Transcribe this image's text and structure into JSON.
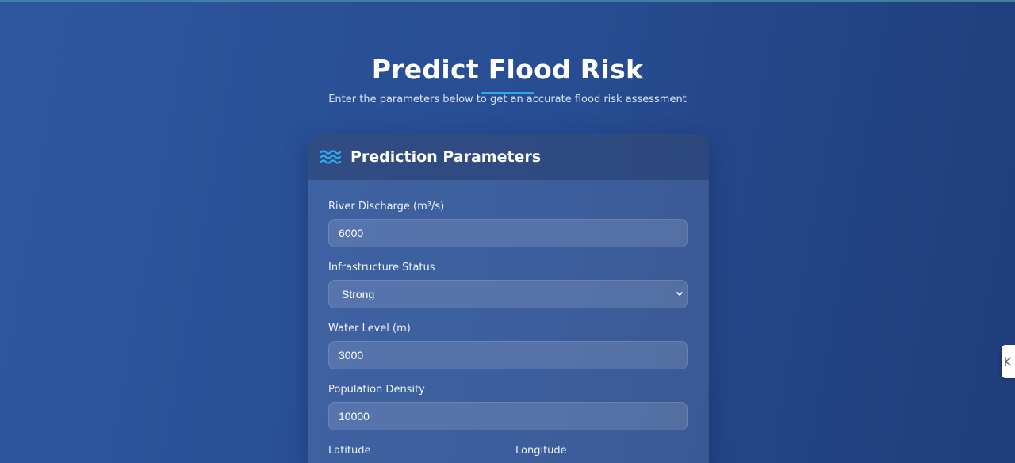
{
  "page": {
    "title": "Predict Flood Risk",
    "subtitle": "Enter the parameters below to get an accurate flood risk assessment"
  },
  "card": {
    "icon": "water-waves-icon",
    "title": "Prediction Parameters",
    "fields": {
      "river_discharge": {
        "label": "River Discharge (m³/s)",
        "value": "6000"
      },
      "infrastructure": {
        "label": "Infrastructure Status",
        "value": "Strong"
      },
      "water_level": {
        "label": "Water Level (m)",
        "value": "3000"
      },
      "population_density": {
        "label": "Population Density",
        "value": "10000"
      },
      "latitude": {
        "label": "Latitude"
      },
      "longitude": {
        "label": "Longitude"
      }
    }
  },
  "side_widget": {
    "icon": "resize-handle-icon"
  },
  "colors": {
    "accent": "#2ba8f0",
    "background": "#2a529b"
  }
}
